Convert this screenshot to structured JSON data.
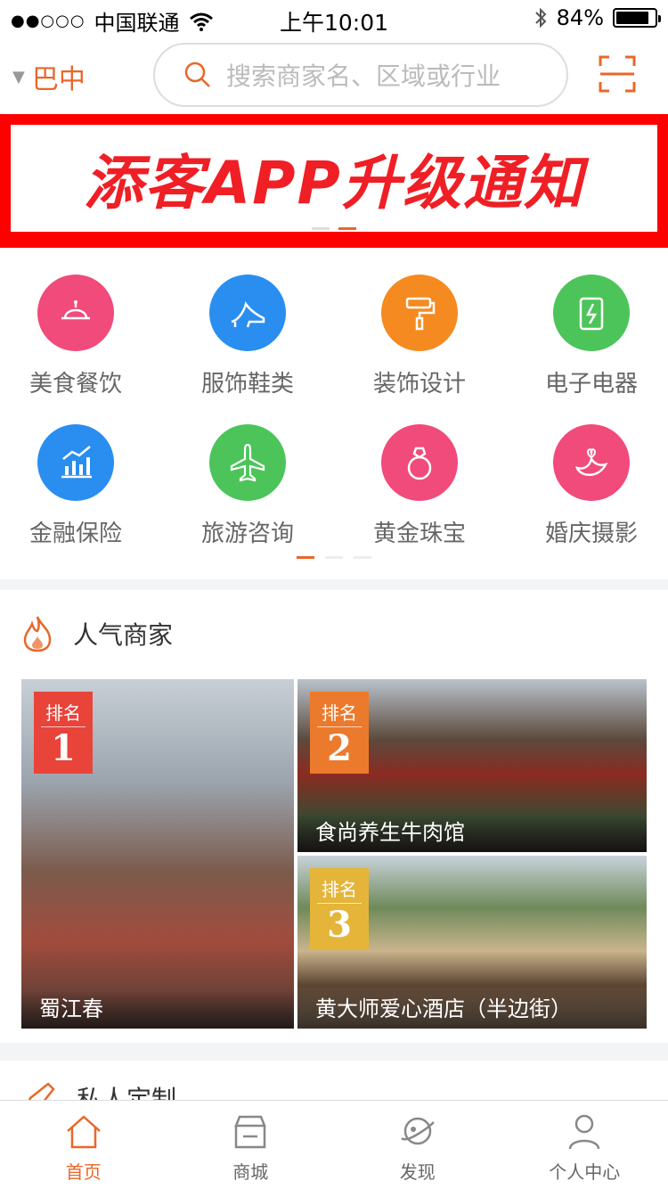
{
  "status_bar": {
    "signal_dots": "●●○○○",
    "carrier": "中国联通",
    "time": "上午10:01",
    "battery": "84%",
    "battery_level": 0.84
  },
  "header": {
    "city": "巴中",
    "search_placeholder": "搜索商家名、区域或行业"
  },
  "banner": {
    "title": "添客APP升级通知",
    "page_count": 2,
    "active_index": 1
  },
  "categories": {
    "items": [
      {
        "label": "美食餐饮",
        "color": "#f04b7a",
        "icon": "cloche-icon"
      },
      {
        "label": "服饰鞋类",
        "color": "#2a8ef0",
        "icon": "high-heel-icon"
      },
      {
        "label": "装饰设计",
        "color": "#f58a20",
        "icon": "paint-roller-icon"
      },
      {
        "label": "电子电器",
        "color": "#4cc45a",
        "icon": "battery-icon"
      },
      {
        "label": "金融保险",
        "color": "#2a8ef0",
        "icon": "chart-icon"
      },
      {
        "label": "旅游咨询",
        "color": "#4cc45a",
        "icon": "airplane-icon"
      },
      {
        "label": "黄金珠宝",
        "color": "#f04b7a",
        "icon": "ring-icon"
      },
      {
        "label": "婚庆摄影",
        "color": "#f04b7a",
        "icon": "bird-icon"
      }
    ],
    "page_count": 3,
    "active_index": 0
  },
  "popular": {
    "title": "人气商家",
    "rank_label": "排名",
    "shops": [
      {
        "rank": "1",
        "name": "蜀江春",
        "rank_color": "#e8443a"
      },
      {
        "rank": "2",
        "name": "食尚养生牛肉馆",
        "rank_color": "#ec7a2c"
      },
      {
        "rank": "3",
        "name": "黄大师爱心酒店（半边街）",
        "rank_color": "#e5b53a"
      }
    ]
  },
  "custom": {
    "title": "私人定制"
  },
  "tabbar": {
    "items": [
      {
        "label": "首页",
        "icon": "home-icon"
      },
      {
        "label": "商城",
        "icon": "store-icon"
      },
      {
        "label": "发现",
        "icon": "planet-icon"
      },
      {
        "label": "个人中心",
        "icon": "user-icon"
      }
    ],
    "active_index": 0
  },
  "colors": {
    "accent": "#e8672a",
    "banner_red": "#ff0000"
  }
}
